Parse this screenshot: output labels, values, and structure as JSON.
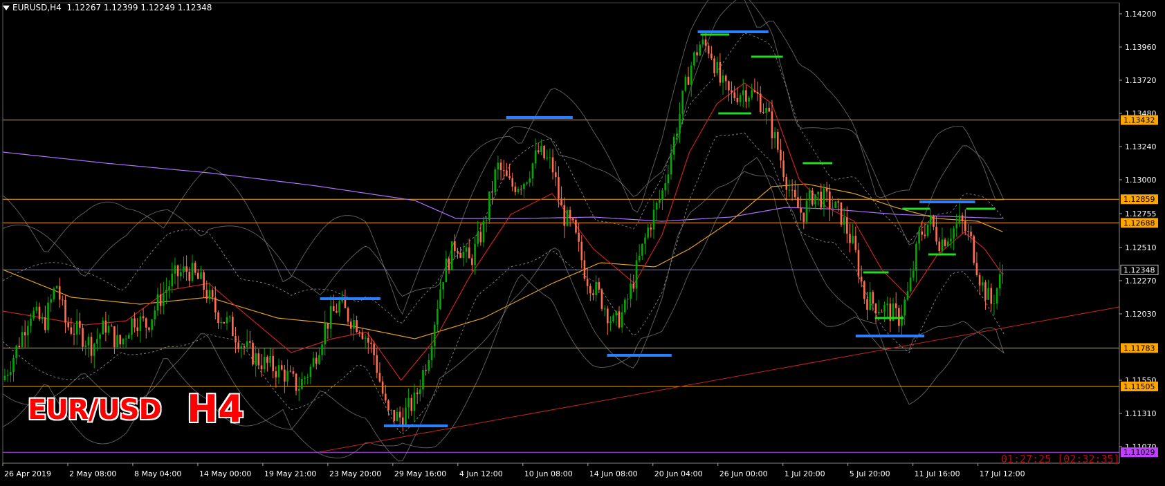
{
  "header": {
    "symbol": "EURUSD,H4",
    "ohlc": "1.12267 1.12399 1.12249 1.12348"
  },
  "labels": {
    "pair": "EUR/USD",
    "timeframe": "H4",
    "timer": "01:27:25 [02:32:35]"
  },
  "colors": {
    "background": "#000000",
    "bull_candle": "#00aa00",
    "bear_candle": "#ff6f4f",
    "level_line": "#ffa500",
    "current_price": "#8a8aa8",
    "ma_fast": "#cc2222",
    "ma_mid": "#e0a020",
    "ma_slow": "#b070ff",
    "bands": "#9a9a9a",
    "resistance_mark": "#2a7fff",
    "support_mark": "#22dd22",
    "trendline": "#cc2222"
  },
  "chart_data": {
    "type": "candlestick",
    "symbol": "EURUSD",
    "timeframe": "H4",
    "ylim": [
      1.1095,
      1.1428
    ],
    "y_ticks": [
      "1.14200",
      "1.13960",
      "1.13720",
      "1.13480",
      "1.13240",
      "1.13000",
      "1.12755",
      "1.12510",
      "1.12270",
      "1.12030",
      "1.11550",
      "1.11310",
      "1.11070"
    ],
    "x_ticks": [
      "26 Apr 2019",
      "2 May 08:00",
      "8 May 04:00",
      "14 May 00:00",
      "19 May 21:00",
      "23 May 20:00",
      "29 May 16:00",
      "4 Jun 12:00",
      "10 Jun 08:00",
      "14 Jun 08:00",
      "20 Jun 04:00",
      "26 Jun 00:00",
      "1 Jul 20:00",
      "5 Jul 20:00",
      "11 Jul 16:00",
      "17 Jul 12:00"
    ],
    "horizontal_levels": [
      {
        "value": 1.13432,
        "label": "1.13432",
        "color": "#ffa500"
      },
      {
        "value": 1.12859,
        "label": "1.12859",
        "color": "#ffa500"
      },
      {
        "value": 1.12688,
        "label": "1.12688",
        "color": "#ffa500"
      },
      {
        "value": 1.11783,
        "label": "1.11783",
        "color": "#ffa500"
      },
      {
        "value": 1.11505,
        "label": "1.11505",
        "color": "#ffa500"
      },
      {
        "value": 1.11029,
        "label": "1.11029",
        "color": "#c040ff"
      }
    ],
    "current_price": {
      "value": 1.12348,
      "label": "1.12348"
    },
    "close_path": [
      [
        0,
        1.1155
      ],
      [
        18,
        1.1175
      ],
      [
        40,
        1.1205
      ],
      [
        60,
        1.1195
      ],
      [
        78,
        1.1225
      ],
      [
        92,
        1.1195
      ],
      [
        110,
        1.119
      ],
      [
        130,
        1.118
      ],
      [
        150,
        1.1195
      ],
      [
        170,
        1.118
      ],
      [
        190,
        1.12
      ],
      [
        210,
        1.1195
      ],
      [
        230,
        1.1215
      ],
      [
        250,
        1.123
      ],
      [
        270,
        1.1235
      ],
      [
        290,
        1.1225
      ],
      [
        310,
        1.1205
      ],
      [
        330,
        1.1195
      ],
      [
        350,
        1.118
      ],
      [
        370,
        1.117
      ],
      [
        390,
        1.1165
      ],
      [
        410,
        1.116
      ],
      [
        430,
        1.115
      ],
      [
        450,
        1.1165
      ],
      [
        470,
        1.1195
      ],
      [
        490,
        1.121
      ],
      [
        505,
        1.12
      ],
      [
        520,
        1.1195
      ],
      [
        540,
        1.1175
      ],
      [
        560,
        1.113
      ],
      [
        580,
        1.1128
      ],
      [
        600,
        1.114
      ],
      [
        620,
        1.1175
      ],
      [
        640,
        1.123
      ],
      [
        660,
        1.1255
      ],
      [
        680,
        1.124
      ],
      [
        700,
        1.1265
      ],
      [
        720,
        1.131
      ],
      [
        740,
        1.1295
      ],
      [
        760,
        1.13
      ],
      [
        780,
        1.132
      ],
      [
        800,
        1.131
      ],
      [
        815,
        1.1275
      ],
      [
        830,
        1.1265
      ],
      [
        850,
        1.123
      ],
      [
        870,
        1.1215
      ],
      [
        890,
        1.1195
      ],
      [
        905,
        1.1205
      ],
      [
        920,
        1.123
      ],
      [
        940,
        1.1265
      ],
      [
        960,
        1.129
      ],
      [
        980,
        1.1335
      ],
      [
        1000,
        1.138
      ],
      [
        1015,
        1.1398
      ],
      [
        1030,
        1.1395
      ],
      [
        1045,
        1.137
      ],
      [
        1060,
        1.136
      ],
      [
        1080,
        1.1365
      ],
      [
        1100,
        1.136
      ],
      [
        1115,
        1.1345
      ],
      [
        1130,
        1.132
      ],
      [
        1150,
        1.1285
      ],
      [
        1165,
        1.1275
      ],
      [
        1180,
        1.129
      ],
      [
        1200,
        1.1285
      ],
      [
        1220,
        1.1275
      ],
      [
        1240,
        1.125
      ],
      [
        1255,
        1.1215
      ],
      [
        1270,
        1.121
      ],
      [
        1290,
        1.1205
      ],
      [
        1305,
        1.12
      ],
      [
        1320,
        1.122
      ],
      [
        1335,
        1.126
      ],
      [
        1350,
        1.127
      ],
      [
        1365,
        1.1255
      ],
      [
        1380,
        1.1262
      ],
      [
        1395,
        1.127
      ],
      [
        1410,
        1.1255
      ],
      [
        1425,
        1.1225
      ],
      [
        1440,
        1.121
      ],
      [
        1450,
        1.1225
      ],
      [
        1458,
        1.12348
      ]
    ],
    "ma_fast": [
      [
        0,
        1.1205
      ],
      [
        60,
        1.12
      ],
      [
        120,
        1.1195
      ],
      [
        180,
        1.1198
      ],
      [
        240,
        1.122
      ],
      [
        300,
        1.1225
      ],
      [
        360,
        1.12
      ],
      [
        420,
        1.1175
      ],
      [
        480,
        1.1185
      ],
      [
        530,
        1.119
      ],
      [
        580,
        1.1155
      ],
      [
        630,
        1.1185
      ],
      [
        680,
        1.123
      ],
      [
        740,
        1.1275
      ],
      [
        800,
        1.129
      ],
      [
        860,
        1.125
      ],
      [
        920,
        1.1225
      ],
      [
        960,
        1.126
      ],
      [
        1000,
        1.132
      ],
      [
        1040,
        1.1355
      ],
      [
        1080,
        1.137
      ],
      [
        1120,
        1.1355
      ],
      [
        1160,
        1.13
      ],
      [
        1200,
        1.128
      ],
      [
        1240,
        1.127
      ],
      [
        1280,
        1.1235
      ],
      [
        1320,
        1.1215
      ],
      [
        1360,
        1.1245
      ],
      [
        1400,
        1.1262
      ],
      [
        1430,
        1.125
      ],
      [
        1458,
        1.123
      ]
    ],
    "ma_mid": [
      [
        0,
        1.1235
      ],
      [
        100,
        1.1215
      ],
      [
        200,
        1.121
      ],
      [
        300,
        1.1215
      ],
      [
        400,
        1.12
      ],
      [
        500,
        1.1195
      ],
      [
        600,
        1.1185
      ],
      [
        700,
        1.12
      ],
      [
        800,
        1.1225
      ],
      [
        870,
        1.124
      ],
      [
        950,
        1.1237
      ],
      [
        1000,
        1.125
      ],
      [
        1060,
        1.127
      ],
      [
        1120,
        1.1295
      ],
      [
        1170,
        1.1297
      ],
      [
        1240,
        1.129
      ],
      [
        1300,
        1.128
      ],
      [
        1360,
        1.1272
      ],
      [
        1420,
        1.127
      ],
      [
        1458,
        1.1262
      ]
    ],
    "ma_slow": [
      [
        0,
        1.132
      ],
      [
        150,
        1.1312
      ],
      [
        300,
        1.1305
      ],
      [
        450,
        1.1296
      ],
      [
        600,
        1.1285
      ],
      [
        660,
        1.1272
      ],
      [
        760,
        1.1272
      ],
      [
        860,
        1.1273
      ],
      [
        960,
        1.127
      ],
      [
        1060,
        1.1273
      ],
      [
        1140,
        1.128
      ],
      [
        1200,
        1.1279
      ],
      [
        1300,
        1.1275
      ],
      [
        1400,
        1.1273
      ],
      [
        1458,
        1.1272
      ]
    ],
    "trendline": {
      "from": [
        460,
        1.1103
      ],
      "to": [
        1626,
        1.1208
      ]
    },
    "resistance_marks": [
      {
        "from": 462,
        "to": 550,
        "value": 1.1214
      },
      {
        "from": 733,
        "to": 830,
        "value": 1.1345
      },
      {
        "from": 1012,
        "to": 1115,
        "value": 1.1407
      },
      {
        "from": 1335,
        "to": 1416,
        "value": 1.1284
      }
    ],
    "support_marks": [
      {
        "from": 555,
        "to": 648,
        "value": 1.1122
      },
      {
        "from": 880,
        "to": 974,
        "value": 1.1173
      },
      {
        "from": 1242,
        "to": 1342,
        "value": 1.1187
      }
    ],
    "green_marks": [
      {
        "from": 1016,
        "to": 1058,
        "value": 1.1405
      },
      {
        "from": 1042,
        "to": 1090,
        "value": 1.1348
      },
      {
        "from": 1090,
        "to": 1136,
        "value": 1.1389
      },
      {
        "from": 1165,
        "to": 1208,
        "value": 1.1312
      },
      {
        "from": 1253,
        "to": 1290,
        "value": 1.1233
      },
      {
        "from": 1270,
        "to": 1312,
        "value": 1.12
      },
      {
        "from": 1310,
        "to": 1350,
        "value": 1.1279
      },
      {
        "from": 1348,
        "to": 1388,
        "value": 1.1246
      },
      {
        "from": 1403,
        "to": 1445,
        "value": 1.1279
      }
    ],
    "grid": false,
    "legend": "none"
  }
}
